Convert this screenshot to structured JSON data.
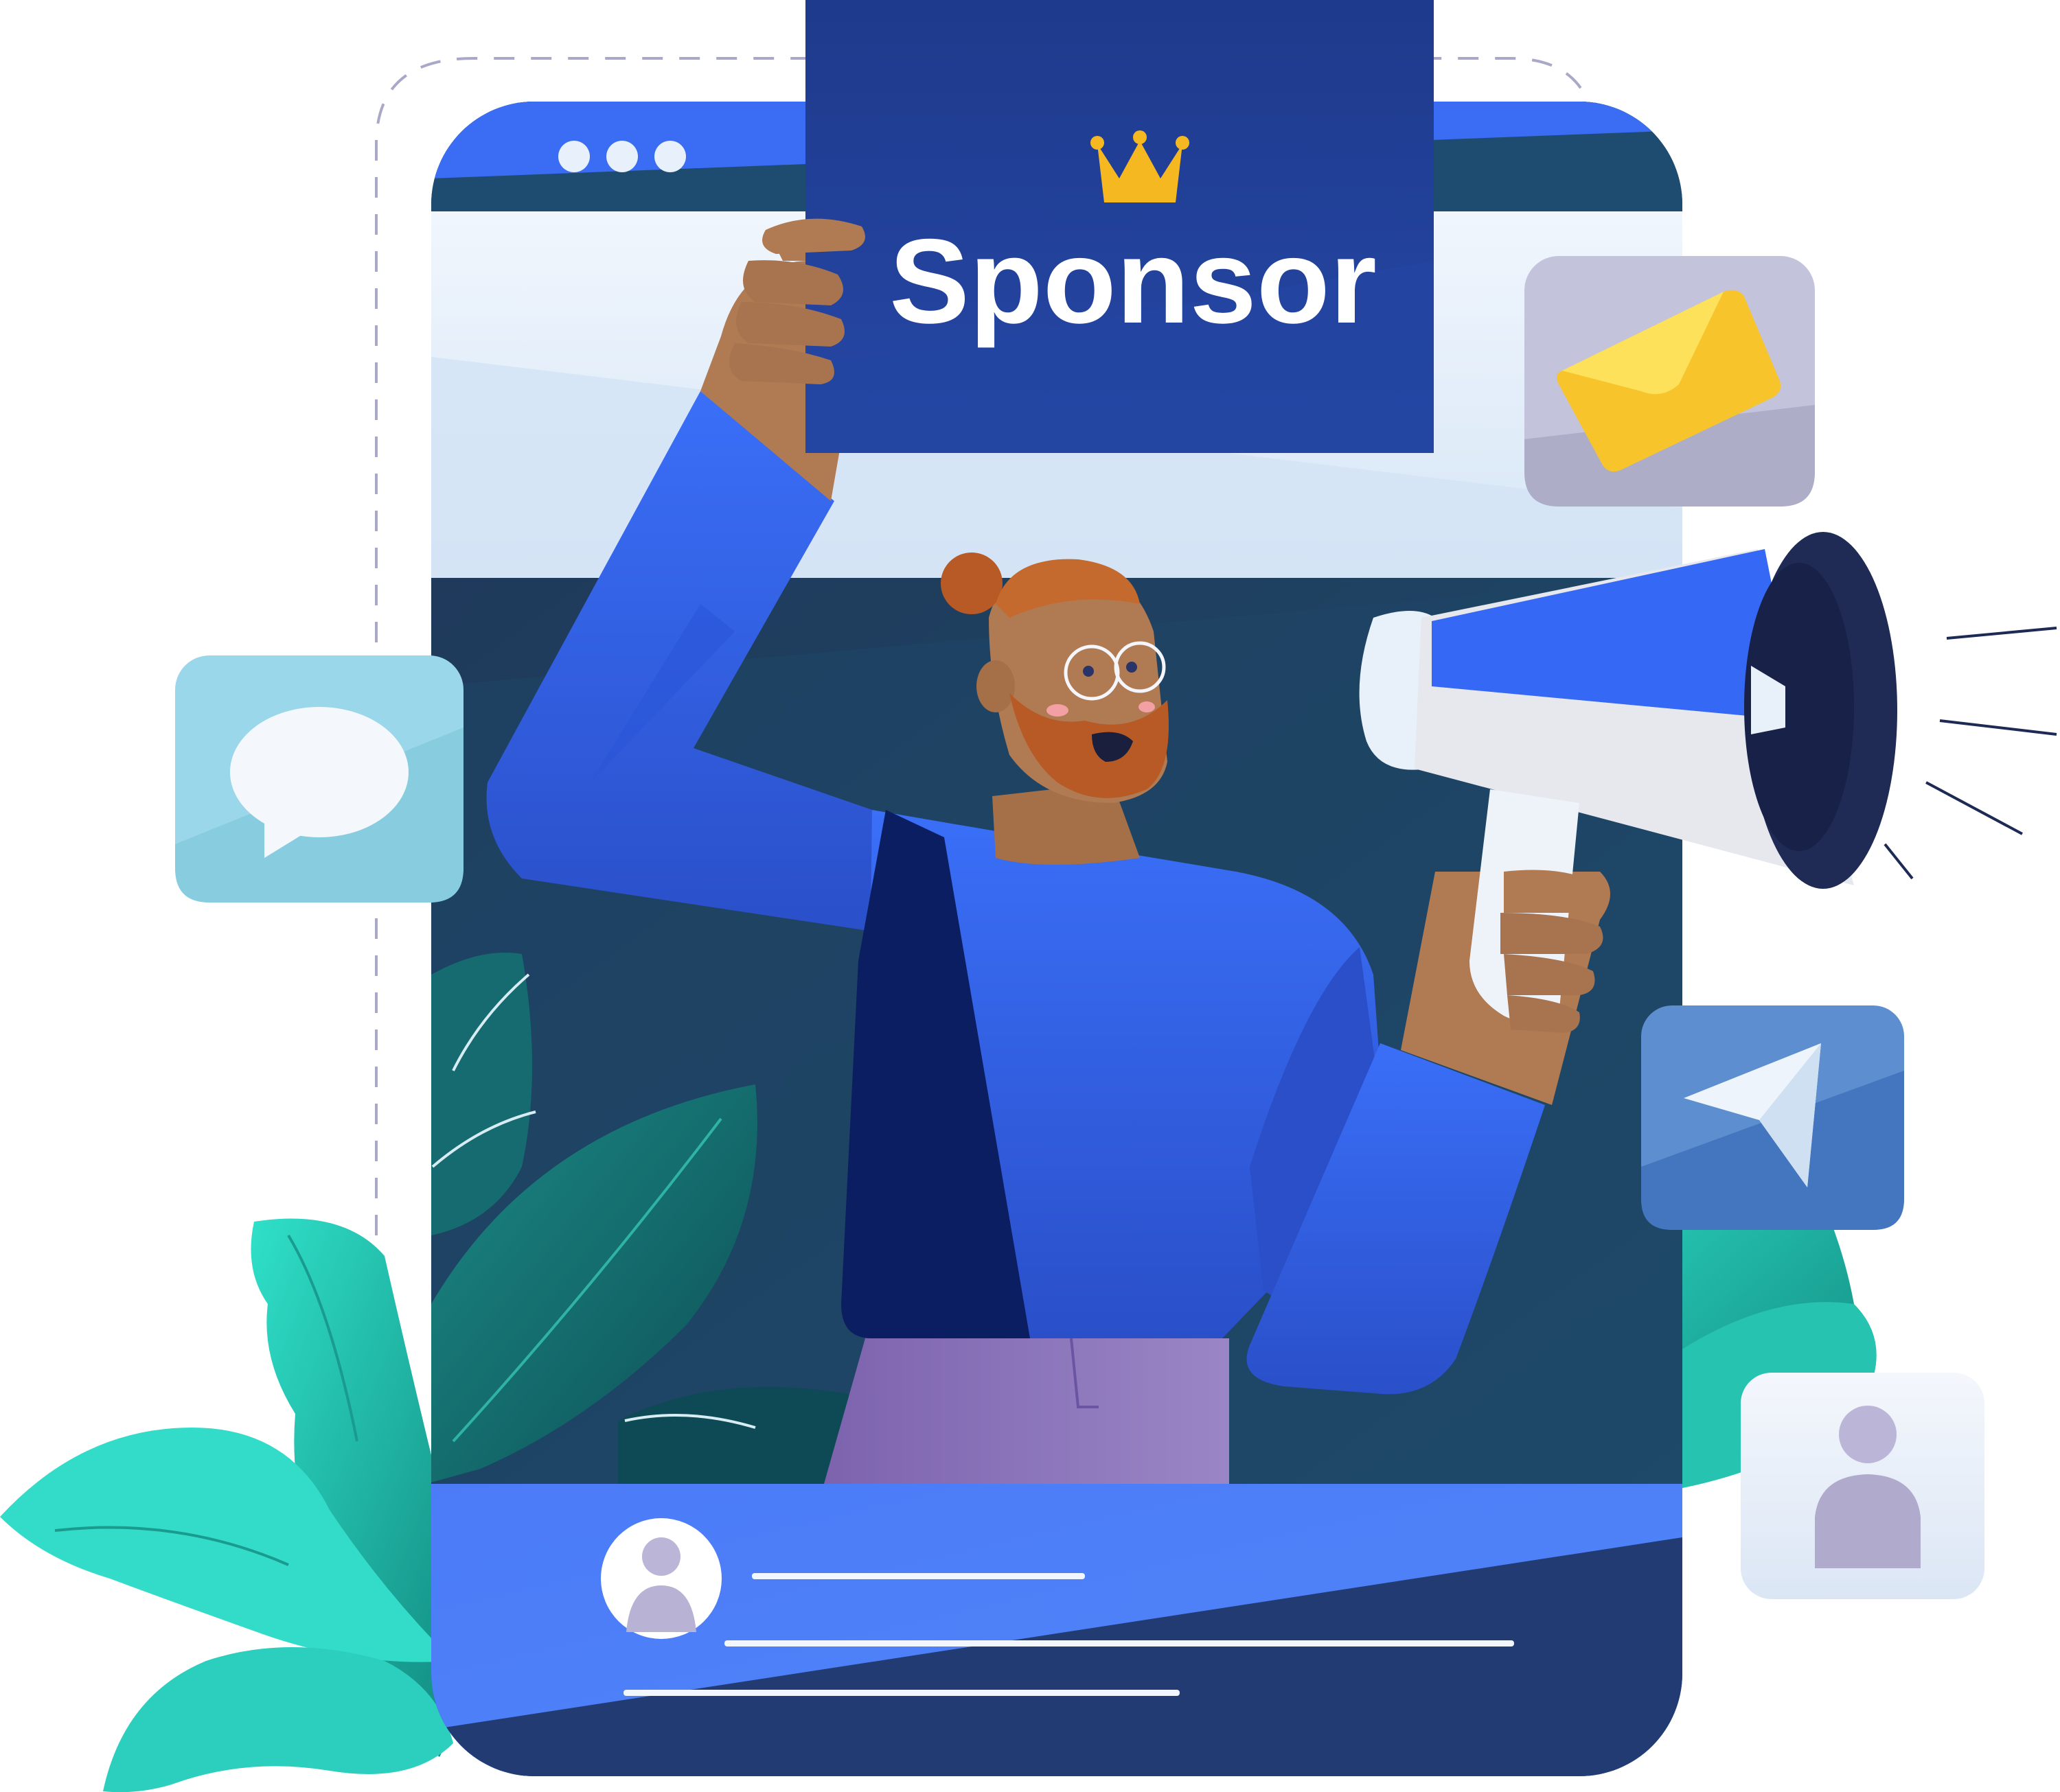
{
  "sign": {
    "label": "Sponsor"
  },
  "colors": {
    "phone_body": "#1f3d62",
    "phone_screen_dark": "#1e4468",
    "top_bar": "#3a6cf4",
    "sign_bg": "#1f3b8f",
    "crown": "#f5b820",
    "sweater": "#3468f5",
    "vest": "#0b1e62",
    "skin": "#b07a52",
    "hair": "#b85a25",
    "pants": "#8b73b8",
    "post_card": "#4e7ef8",
    "leaf_teal": "#2bd6c2",
    "leaf_dark": "#145d5c",
    "email_tile": "#c3c3dc",
    "chat_tile": "#9ad7ea",
    "send_tile": "#4d7fca",
    "profile_tile": "#e6eef8",
    "envelope": "#f7c52b"
  },
  "icons": {
    "window_controls": "three-dots-icon",
    "crown": "crown-icon",
    "email": "envelope-icon",
    "chat": "speech-bubble-icon",
    "send": "paper-plane-icon",
    "profile": "user-icon",
    "megaphone": "megaphone-icon",
    "post_avatar": "avatar-icon"
  }
}
